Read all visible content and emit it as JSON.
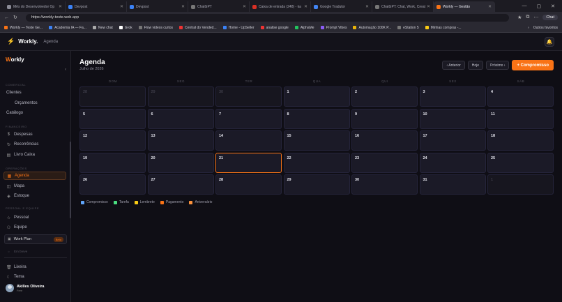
{
  "browser": {
    "tabs": [
      {
        "label": "Mês do Desenvolvedor Op",
        "color": "#8b8b96",
        "active": false
      },
      {
        "label": "Devpost",
        "color": "#3b82f6",
        "active": false
      },
      {
        "label": "Devpost",
        "color": "#3b82f6",
        "active": false
      },
      {
        "label": "ChatGPT",
        "color": "#777777",
        "active": false
      },
      {
        "label": "Caixa de entrada (248) - ka",
        "color": "#d93025",
        "active": false
      },
      {
        "label": "Google Tradutor",
        "color": "#4285f4",
        "active": false
      },
      {
        "label": "ChatGPT: Chat, Work, Creat",
        "color": "#777777",
        "active": false
      },
      {
        "label": "Workly — Gestão",
        "color": "#f97316",
        "active": true
      }
    ],
    "url": "https://workly-teste.web.app",
    "chat_label": "Chat",
    "bookmarks": [
      {
        "label": "Workly — Teste Ge...",
        "color": "#f97316"
      },
      {
        "label": "Academia IA — Fa...",
        "color": "#3b82f6"
      },
      {
        "label": "New chat",
        "color": "#aaaaaa"
      },
      {
        "label": "Grok",
        "color": "#ffffff"
      },
      {
        "label": "Flow videos curtos",
        "color": "#777777"
      },
      {
        "label": "Central do Vended...",
        "color": "#e33"
      },
      {
        "label": "Home - UpSeller",
        "color": "#3b82f6"
      },
      {
        "label": "analise google",
        "color": "#e33"
      },
      {
        "label": "AlphaMe",
        "color": "#22c55e"
      },
      {
        "label": "Prompt Vibes",
        "color": "#8b5cf6"
      },
      {
        "label": "Automação 100K P...",
        "color": "#eab308"
      },
      {
        "label": "eStation 5",
        "color": "#777777"
      },
      {
        "label": "Minhas compras -...",
        "color": "#facc15"
      }
    ],
    "other_bookmarks": "Outros favoritos"
  },
  "topbar": {
    "brand": "Workly.",
    "crumb": "Agenda"
  },
  "sidebar": {
    "logo_w": "W",
    "logo_rest": "orkly",
    "sections": {
      "comercial": "COMERCIAL",
      "financeiro": "FINANCEIRO",
      "operacoes": "OPERAÇÕES",
      "pessoal": "PESSOAL E EQUIPE"
    },
    "items": {
      "clientes": "Clientes",
      "orcamentos": "Orçamentos",
      "catalogo": "Catálogo",
      "despesas": "Despesas",
      "recorrencias": "Recorrências",
      "livro_caixa": "Livro Caixa",
      "agenda": "Agenda",
      "mapa": "Mapa",
      "estoque": "Estoque",
      "pessoal": "Pessoal",
      "equipe": "Equipe",
      "lixeira": "Lixeira",
      "tema": "Tema"
    },
    "workplan": "Work Plan",
    "beta": "Beta",
    "em_breve": "Em breve",
    "user_name": "Akilles Oliveira",
    "user_role": "Free"
  },
  "main": {
    "title": "Agenda",
    "subtitle": "Julho de 2026",
    "prev": "‹ Anterior",
    "today": "Hoje",
    "next": "Próximo ›",
    "add": "+ Compromisso",
    "weekdays": [
      "DOM",
      "SEG",
      "TER",
      "QUA",
      "QUI",
      "SEX",
      "SÁB"
    ],
    "days": [
      "28",
      "29",
      "30",
      "1",
      "2",
      "3",
      "4",
      "5",
      "6",
      "7",
      "8",
      "9",
      "10",
      "11",
      "12",
      "13",
      "14",
      "15",
      "16",
      "17",
      "18",
      "19",
      "20",
      "21",
      "22",
      "23",
      "24",
      "25",
      "26",
      "27",
      "28",
      "29",
      "30",
      "31",
      "1"
    ],
    "outside": [
      0,
      1,
      2,
      34
    ],
    "today_index": 23,
    "legend": [
      {
        "label": "Compromisso",
        "color": "#60a5fa"
      },
      {
        "label": "Tarefa",
        "color": "#4ade80"
      },
      {
        "label": "Lembrete",
        "color": "#facc15"
      },
      {
        "label": "Pagamento",
        "color": "#f97316"
      },
      {
        "label": "Aniversário",
        "color": "#fb923c"
      }
    ]
  }
}
